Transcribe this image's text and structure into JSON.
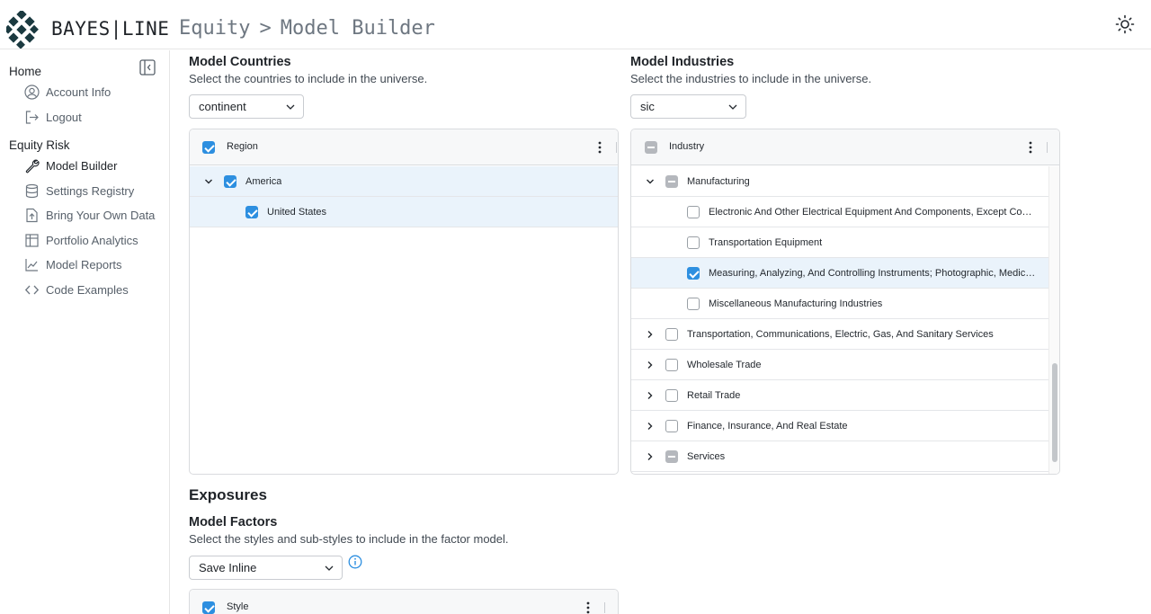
{
  "header": {
    "brand": "BAYES|LINE",
    "breadcrumb": [
      "Equity",
      "Model Builder"
    ],
    "breadcrumb_sep": ">",
    "theme_icon": "sun-icon",
    "logo_color": "#1b3a40"
  },
  "sidebar": {
    "collapse_icon": "collapse-sidebar-icon",
    "sections": [
      {
        "title": "Home",
        "items": [
          {
            "label": "Account Info",
            "icon": "user-circle-icon"
          },
          {
            "label": "Logout",
            "icon": "logout-icon"
          }
        ]
      },
      {
        "title": "Equity Risk",
        "items": [
          {
            "label": "Model Builder",
            "icon": "wrench-icon",
            "active": true
          },
          {
            "label": "Settings Registry",
            "icon": "database-icon"
          },
          {
            "label": "Bring Your Own Data",
            "icon": "file-upload-icon"
          },
          {
            "label": "Portfolio Analytics",
            "icon": "table-icon"
          },
          {
            "label": "Model Reports",
            "icon": "line-chart-icon"
          },
          {
            "label": "Code Examples",
            "icon": "code-icon"
          }
        ]
      }
    ]
  },
  "countries": {
    "title": "Model Countries",
    "description": "Select the countries to include in the universe.",
    "select_value": "continent",
    "grid": {
      "header": "Region",
      "header_checked": true,
      "rows": [
        {
          "label": "America",
          "level": 0,
          "expanded": true,
          "checked": true
        },
        {
          "label": "United States",
          "level": 1,
          "checked": true
        }
      ]
    }
  },
  "industries": {
    "title": "Model Industries",
    "description": "Select the industries to include in the universe.",
    "select_value": "sic",
    "grid": {
      "header": "Industry",
      "header_state": "indeterminate",
      "rows": [
        {
          "label": "Manufacturing",
          "level": 0,
          "expanded": true,
          "state": "indeterminate"
        },
        {
          "label": "Electronic And Other Electrical Equipment And Components, Except Comput…",
          "level": 1,
          "state": "unchecked"
        },
        {
          "label": "Transportation Equipment",
          "level": 1,
          "state": "unchecked"
        },
        {
          "label": "Measuring, Analyzing, And Controlling Instruments; Photographic, Medical A…",
          "level": 1,
          "state": "checked",
          "selected": true
        },
        {
          "label": "Miscellaneous Manufacturing Industries",
          "level": 1,
          "state": "unchecked"
        },
        {
          "label": "Transportation, Communications, Electric, Gas, And Sanitary Services",
          "level": 0,
          "expanded": false,
          "state": "unchecked"
        },
        {
          "label": "Wholesale Trade",
          "level": 0,
          "expanded": false,
          "state": "unchecked"
        },
        {
          "label": "Retail Trade",
          "level": 0,
          "expanded": false,
          "state": "unchecked"
        },
        {
          "label": "Finance, Insurance, And Real Estate",
          "level": 0,
          "expanded": false,
          "state": "unchecked"
        },
        {
          "label": "Services",
          "level": 0,
          "expanded": false,
          "state": "indeterminate"
        }
      ]
    }
  },
  "exposures": {
    "title": "Exposures",
    "factors_title": "Model Factors",
    "factors_description": "Select the styles and sub-styles to include in the factor model.",
    "select_value": "Save Inline",
    "info_icon": "info-circle-icon",
    "grid": {
      "header": "Style",
      "header_checked": true
    }
  },
  "colors": {
    "accent": "#2d8fe0",
    "selected_row": "#eaf3fb",
    "indeterminate": "#b5b8bd"
  }
}
